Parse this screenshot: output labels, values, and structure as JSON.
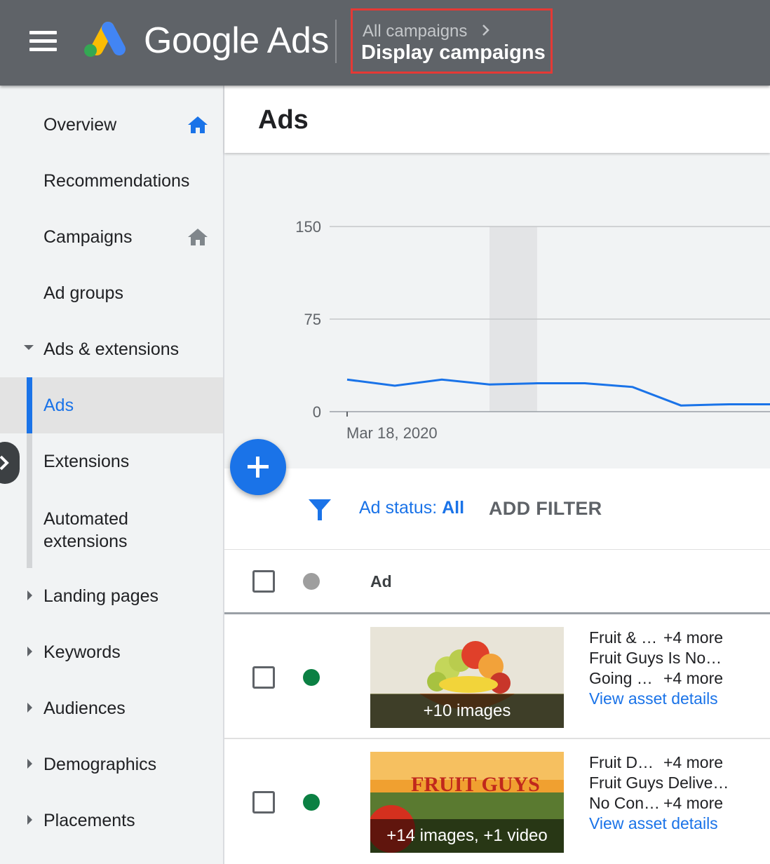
{
  "topbar": {
    "brand": "Google Ads",
    "breadcrumb_parent": "All campaigns",
    "breadcrumb_current": "Display campaigns"
  },
  "sidebar": {
    "items": [
      {
        "label": "Overview"
      },
      {
        "label": "Recommendations"
      },
      {
        "label": "Campaigns"
      },
      {
        "label": "Ad groups"
      },
      {
        "label": "Ads & extensions"
      },
      {
        "label": "Ads"
      },
      {
        "label": "Extensions"
      },
      {
        "label": "Automated extensions"
      },
      {
        "label": "Landing pages"
      },
      {
        "label": "Keywords"
      },
      {
        "label": "Audiences"
      },
      {
        "label": "Demographics"
      },
      {
        "label": "Placements"
      }
    ]
  },
  "main": {
    "title": "Ads"
  },
  "chart_data": {
    "type": "line",
    "y_ticks": [
      "150",
      "75",
      "0"
    ],
    "ylim": [
      0,
      150
    ],
    "x_label_first": "Mar 18, 2020",
    "series": [
      {
        "values": [
          26,
          21,
          26,
          22,
          23,
          23,
          20,
          5,
          6,
          6
        ]
      }
    ],
    "line_color": "#1a73e8"
  },
  "filters": {
    "status_label": "Ad status:",
    "status_value": "All",
    "add_filter": "ADD FILTER"
  },
  "table": {
    "column_ad": "Ad",
    "rows": [
      {
        "thumb_caption": "+10 images",
        "line1": "Fruit & …",
        "line1_more": "+4 more",
        "line2": "Fruit Guys Is No…",
        "line3": "Going …",
        "line3_more": "+4 more",
        "link": "View asset details",
        "status_color": "#0b8043"
      },
      {
        "thumb_caption": "+14 images, +1 video",
        "thumb_title": "FRUIT GUYS",
        "line1": "Fruit D…",
        "line1_more": "+4 more",
        "line2": "Fruit Guys Delive…",
        "line3": "No Con…",
        "line3_more": "+4 more",
        "link": "View asset details",
        "status_color": "#0b8043"
      }
    ]
  },
  "colors": {
    "topbar": "#5f6368",
    "accent": "#1a73e8",
    "enabled_status": "#0b8043"
  }
}
